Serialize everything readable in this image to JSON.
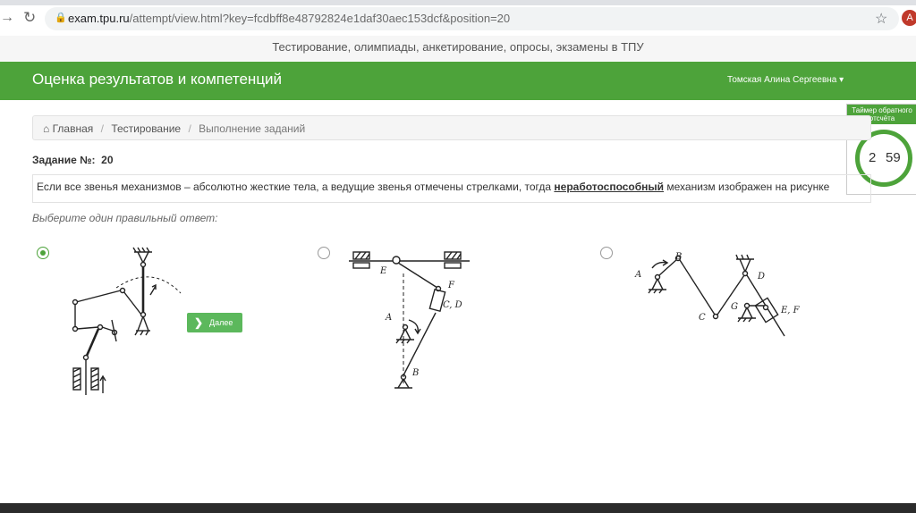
{
  "browser": {
    "url_host": "exam.tpu.ru",
    "url_path": "/attempt/view.html?key=fcdbff8e48792824e1daf30aec153dcf&position=20",
    "avatar_letter": "A"
  },
  "site": {
    "subtitle": "Тестирование, олимпиады, анкетирование, опросы, экзамены в ТПУ",
    "brand": "Оценка результатов и компетенций",
    "user_name": "Томская Алина Сергеевна",
    "brand_color": "#4da33a"
  },
  "timer": {
    "title": "Таймер обратного отсчёта",
    "minutes": "2",
    "seconds": "59"
  },
  "breadcrumb": {
    "home": "Главная",
    "testing": "Тестирование",
    "current": "Выполнение заданий"
  },
  "task": {
    "label": "Задание №:",
    "number": "20",
    "text_before": "Если все звенья механизмов – абсолютно жесткие тела, а ведущие звенья отмечены стрелками, тогда",
    "text_bold": "неработоспособный",
    "text_after": "механизм изображен на рисунке",
    "hint": "Выберите один правильный ответ:",
    "next_label": "Далее"
  },
  "options": [
    {
      "selected": true
    },
    {
      "selected": false,
      "labels": [
        "E",
        "F",
        "C, D",
        "A",
        "B"
      ]
    },
    {
      "selected": false,
      "labels": [
        "A",
        "B",
        "C",
        "D",
        "G",
        "E, F"
      ]
    }
  ]
}
